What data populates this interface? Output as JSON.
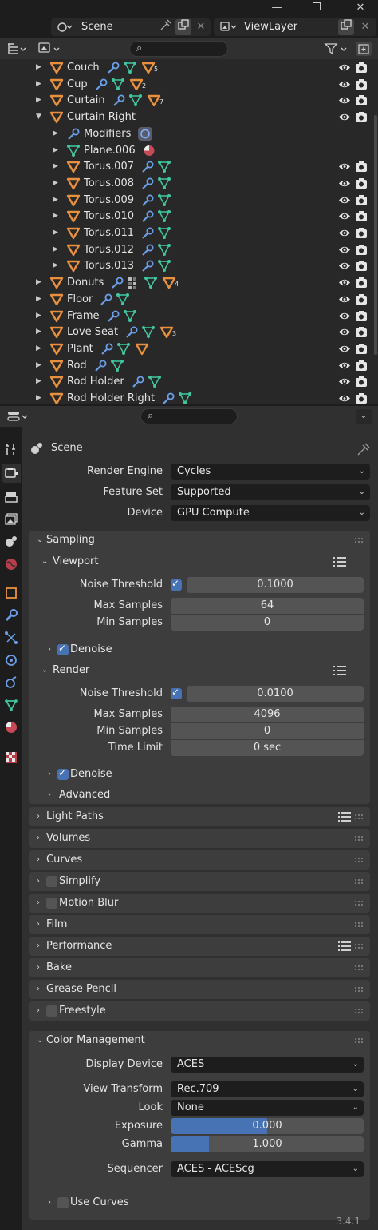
{
  "header": {
    "scene_label": "Scene",
    "viewlayer_label": "ViewLayer"
  },
  "outliner": {
    "rows": [
      {
        "indent": 0,
        "expanded": false,
        "icon": "object-triangle-icon",
        "name": "Couch",
        "extras": [
          "wrench",
          "mesh",
          "tri"
        ],
        "sub": "5",
        "vis": true
      },
      {
        "indent": 0,
        "expanded": false,
        "icon": "object-triangle-icon",
        "name": "Cup",
        "extras": [
          "wrench",
          "mesh",
          "tri"
        ],
        "sub": "2",
        "vis": true
      },
      {
        "indent": 0,
        "expanded": false,
        "icon": "object-triangle-icon",
        "name": "Curtain",
        "extras": [
          "wrench",
          "mesh",
          "tri"
        ],
        "sub": "7",
        "vis": true
      },
      {
        "indent": 0,
        "expanded": true,
        "icon": "object-triangle-icon",
        "name": "Curtain Right",
        "extras": [],
        "sub": "",
        "vis": true
      },
      {
        "indent": 1,
        "expanded": false,
        "icon": "wrench-icon",
        "name": "Modifiers",
        "extras": [
          "modifier"
        ],
        "sub": "",
        "vis": false
      },
      {
        "indent": 1,
        "expanded": false,
        "icon": "mesh-icon",
        "name": "Plane.006",
        "extras": [
          "material"
        ],
        "sub": "",
        "vis": false
      },
      {
        "indent": 1,
        "expanded": false,
        "icon": "object-triangle-icon",
        "name": "Torus.007",
        "extras": [
          "wrench",
          "mesh"
        ],
        "sub": "",
        "vis": true
      },
      {
        "indent": 1,
        "expanded": false,
        "icon": "object-triangle-icon",
        "name": "Torus.008",
        "extras": [
          "wrench",
          "mesh"
        ],
        "sub": "",
        "vis": true
      },
      {
        "indent": 1,
        "expanded": false,
        "icon": "object-triangle-icon",
        "name": "Torus.009",
        "extras": [
          "wrench",
          "mesh"
        ],
        "sub": "",
        "vis": true
      },
      {
        "indent": 1,
        "expanded": false,
        "icon": "object-triangle-icon",
        "name": "Torus.010",
        "extras": [
          "wrench",
          "mesh"
        ],
        "sub": "",
        "vis": true
      },
      {
        "indent": 1,
        "expanded": false,
        "icon": "object-triangle-icon",
        "name": "Torus.011",
        "extras": [
          "wrench",
          "mesh"
        ],
        "sub": "",
        "vis": true
      },
      {
        "indent": 1,
        "expanded": false,
        "icon": "object-triangle-icon",
        "name": "Torus.012",
        "extras": [
          "wrench",
          "mesh"
        ],
        "sub": "",
        "vis": true
      },
      {
        "indent": 1,
        "expanded": false,
        "icon": "object-triangle-icon",
        "name": "Torus.013",
        "extras": [
          "wrench",
          "mesh"
        ],
        "sub": "",
        "vis": true
      },
      {
        "indent": 0,
        "expanded": false,
        "icon": "object-triangle-icon",
        "name": "Donuts",
        "extras": [
          "wrench",
          "particles",
          "mesh",
          "tri"
        ],
        "sub": "4",
        "vis": true
      },
      {
        "indent": 0,
        "expanded": false,
        "icon": "object-triangle-icon",
        "name": "Floor",
        "extras": [
          "wrench",
          "mesh"
        ],
        "sub": "",
        "vis": true
      },
      {
        "indent": 0,
        "expanded": false,
        "icon": "object-triangle-icon",
        "name": "Frame",
        "extras": [
          "wrench",
          "mesh"
        ],
        "sub": "",
        "vis": true
      },
      {
        "indent": 0,
        "expanded": false,
        "icon": "object-triangle-icon",
        "name": "Love Seat",
        "extras": [
          "wrench",
          "mesh",
          "tri"
        ],
        "sub": "3",
        "vis": true
      },
      {
        "indent": 0,
        "expanded": false,
        "icon": "object-triangle-icon",
        "name": "Plant",
        "extras": [
          "wrench",
          "mesh",
          "tri"
        ],
        "sub": "",
        "vis": true
      },
      {
        "indent": 0,
        "expanded": false,
        "icon": "object-triangle-icon",
        "name": "Rod",
        "extras": [
          "wrench",
          "mesh"
        ],
        "sub": "",
        "vis": true
      },
      {
        "indent": 0,
        "expanded": false,
        "icon": "object-triangle-icon",
        "name": "Rod Holder",
        "extras": [
          "wrench",
          "mesh"
        ],
        "sub": "",
        "vis": true
      },
      {
        "indent": 0,
        "expanded": false,
        "icon": "object-triangle-icon",
        "name": "Rod Holder Right",
        "extras": [
          "wrench",
          "mesh"
        ],
        "sub": "",
        "vis": true
      }
    ]
  },
  "properties": {
    "context_label": "Scene",
    "render_engine": {
      "label": "Render Engine",
      "value": "Cycles"
    },
    "feature_set": {
      "label": "Feature Set",
      "value": "Supported"
    },
    "device": {
      "label": "Device",
      "value": "GPU Compute"
    },
    "sampling": {
      "title": "Sampling",
      "viewport": {
        "title": "Viewport",
        "noise_threshold_label": "Noise Threshold",
        "noise_threshold": "0.1000",
        "max_samples_label": "Max Samples",
        "max_samples": "64",
        "min_samples_label": "Min Samples",
        "min_samples": "0",
        "denoise_label": "Denoise"
      },
      "render": {
        "title": "Render",
        "noise_threshold_label": "Noise Threshold",
        "noise_threshold": "0.0100",
        "max_samples_label": "Max Samples",
        "max_samples": "4096",
        "min_samples_label": "Min Samples",
        "min_samples": "0",
        "time_limit_label": "Time Limit",
        "time_limit": "0 sec",
        "denoise_label": "Denoise"
      },
      "advanced_label": "Advanced"
    },
    "panels": [
      {
        "title": "Light Paths",
        "checkbox": false,
        "list": true
      },
      {
        "title": "Volumes",
        "checkbox": false,
        "list": false
      },
      {
        "title": "Curves",
        "checkbox": false,
        "list": false
      },
      {
        "title": "Simplify",
        "checkbox": true,
        "list": false
      },
      {
        "title": "Motion Blur",
        "checkbox": true,
        "list": false
      },
      {
        "title": "Film",
        "checkbox": false,
        "list": false
      },
      {
        "title": "Performance",
        "checkbox": false,
        "list": true
      },
      {
        "title": "Bake",
        "checkbox": false,
        "list": false
      },
      {
        "title": "Grease Pencil",
        "checkbox": false,
        "list": false
      },
      {
        "title": "Freestyle",
        "checkbox": true,
        "list": false
      }
    ],
    "color_management": {
      "title": "Color Management",
      "display_device_label": "Display Device",
      "display_device": "ACES",
      "view_transform_label": "View Transform",
      "view_transform": "Rec.709",
      "look_label": "Look",
      "look": "None",
      "exposure_label": "Exposure",
      "exposure": "0.000",
      "exposure_fill_fraction": 0.5,
      "gamma_label": "Gamma",
      "gamma": "1.000",
      "gamma_fill_fraction": 0.2,
      "sequencer_label": "Sequencer",
      "sequencer": "ACES - ACEScg",
      "use_curves_label": "Use Curves"
    }
  },
  "status": {
    "version": "3.4.1"
  },
  "colors": {
    "object_orange": "#e8903d",
    "mesh_green": "#3fc8a0",
    "wrench_blue": "#6a9ee8",
    "accent_blue": "#4772b3"
  }
}
